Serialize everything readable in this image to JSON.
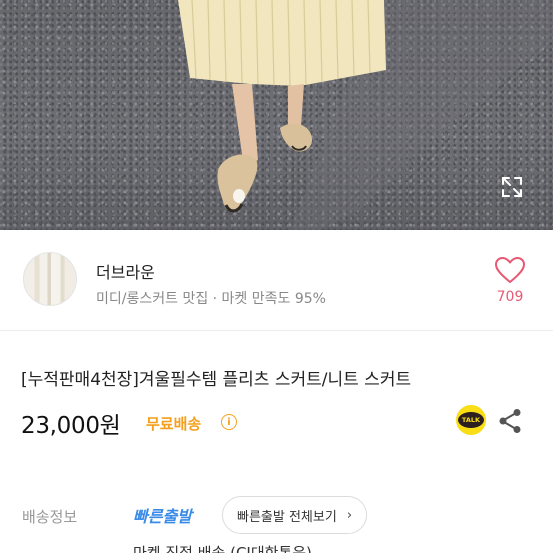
{
  "photo": {
    "expand_icon": "expand-arrows-icon"
  },
  "seller": {
    "name": "더브라운",
    "subtitle": "미디/롱스커트 맛집 · 마켓 만족도 95%",
    "like_icon": "heart-outline-icon",
    "like_count": "709"
  },
  "product": {
    "title": "[누적판매4천장]겨울필수템 플리츠 스커트/니트 스커트",
    "price": "23,000원",
    "free_shipping": "무료배송",
    "info_icon": "info-icon",
    "talk_label": "TALK",
    "share_icon": "share-icon"
  },
  "shipping": {
    "label": "배송정보",
    "fast_tag": "빠른출발",
    "fast_all_button": "빠른출발 전체보기",
    "detail": "마켓 직접 배송 (CJ대한통운)"
  },
  "colors": {
    "accent_pink": "#e85a73",
    "free_ship_orange": "#f4a01c",
    "fast_blue": "#3a8be8",
    "kakao_yellow": "#f9dd15"
  }
}
